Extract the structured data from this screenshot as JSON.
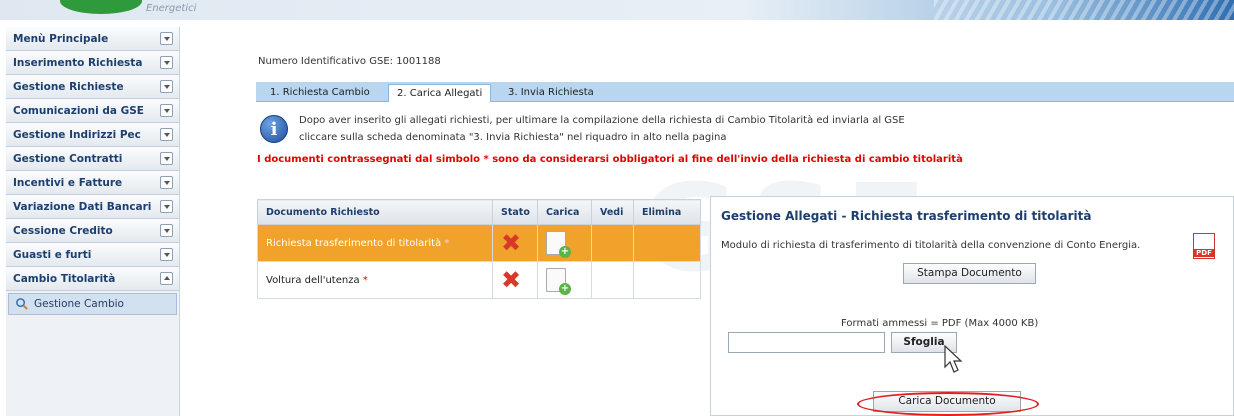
{
  "banner": {
    "brand_text": "Energetici"
  },
  "sidebar": {
    "items": [
      {
        "label": "Menù Principale"
      },
      {
        "label": "Inserimento Richiesta"
      },
      {
        "label": "Gestione Richieste"
      },
      {
        "label": "Comunicazioni da GSE"
      },
      {
        "label": "Gestione Indirizzi Pec"
      },
      {
        "label": "Gestione Contratti"
      },
      {
        "label": "Incentivi e Fatture"
      },
      {
        "label": "Variazione Dati Bancari"
      },
      {
        "label": "Cessione Credito"
      },
      {
        "label": "Guasti e furti"
      },
      {
        "label": "Cambio Titolarità"
      }
    ],
    "sub_item": {
      "label": "Gestione Cambio"
    }
  },
  "main": {
    "id_line": "Numero Identificativo GSE: 1001188",
    "tabs": [
      {
        "label": "1. Richiesta Cambio"
      },
      {
        "label": "2. Carica Allegati"
      },
      {
        "label": "3. Invia Richiesta"
      }
    ],
    "info_line1": "Dopo aver inserito gli allegati richiesti, per ultimare la compilazione della richiesta di Cambio Titolarità ed inviarla al GSE",
    "info_line2": "cliccare sulla scheda denominata \"3. Invia Richiesta\" nel riquadro in alto nella pagina",
    "warning": "I documenti contrassegnati dal simbolo * sono da considerarsi obbligatori al fine dell'invio della richiesta di cambio titolarità",
    "watermark": "GSE"
  },
  "table": {
    "headers": [
      "Documento Richiesto",
      "Stato",
      "Carica",
      "Vedi",
      "Elimina"
    ],
    "rows": [
      {
        "doc": "Richiesta trasferimento di titolarità",
        "req": "*"
      },
      {
        "doc": "Voltura dell'utenza",
        "req": "*"
      }
    ],
    "status_icon": "x-mark-icon",
    "upload_icon": "document-add-icon"
  },
  "panel": {
    "title": "Gestione Allegati - Richiesta trasferimento di titolarità",
    "description": "Modulo di richiesta di trasferimento di titolarità della convenzione di Conto Energia.",
    "pdf_label": "PDF",
    "print_button": "Stampa Documento",
    "formats": "Formati ammessi = PDF (Max 4000 KB)",
    "file_value": "",
    "browse_button": "Sfoglia",
    "upload_button": "Carica Documento"
  },
  "colors": {
    "accent": "#1e3f6e",
    "selected_row": "#f0a22a",
    "warning": "#e00000",
    "highlight_ring": "#e02020"
  }
}
